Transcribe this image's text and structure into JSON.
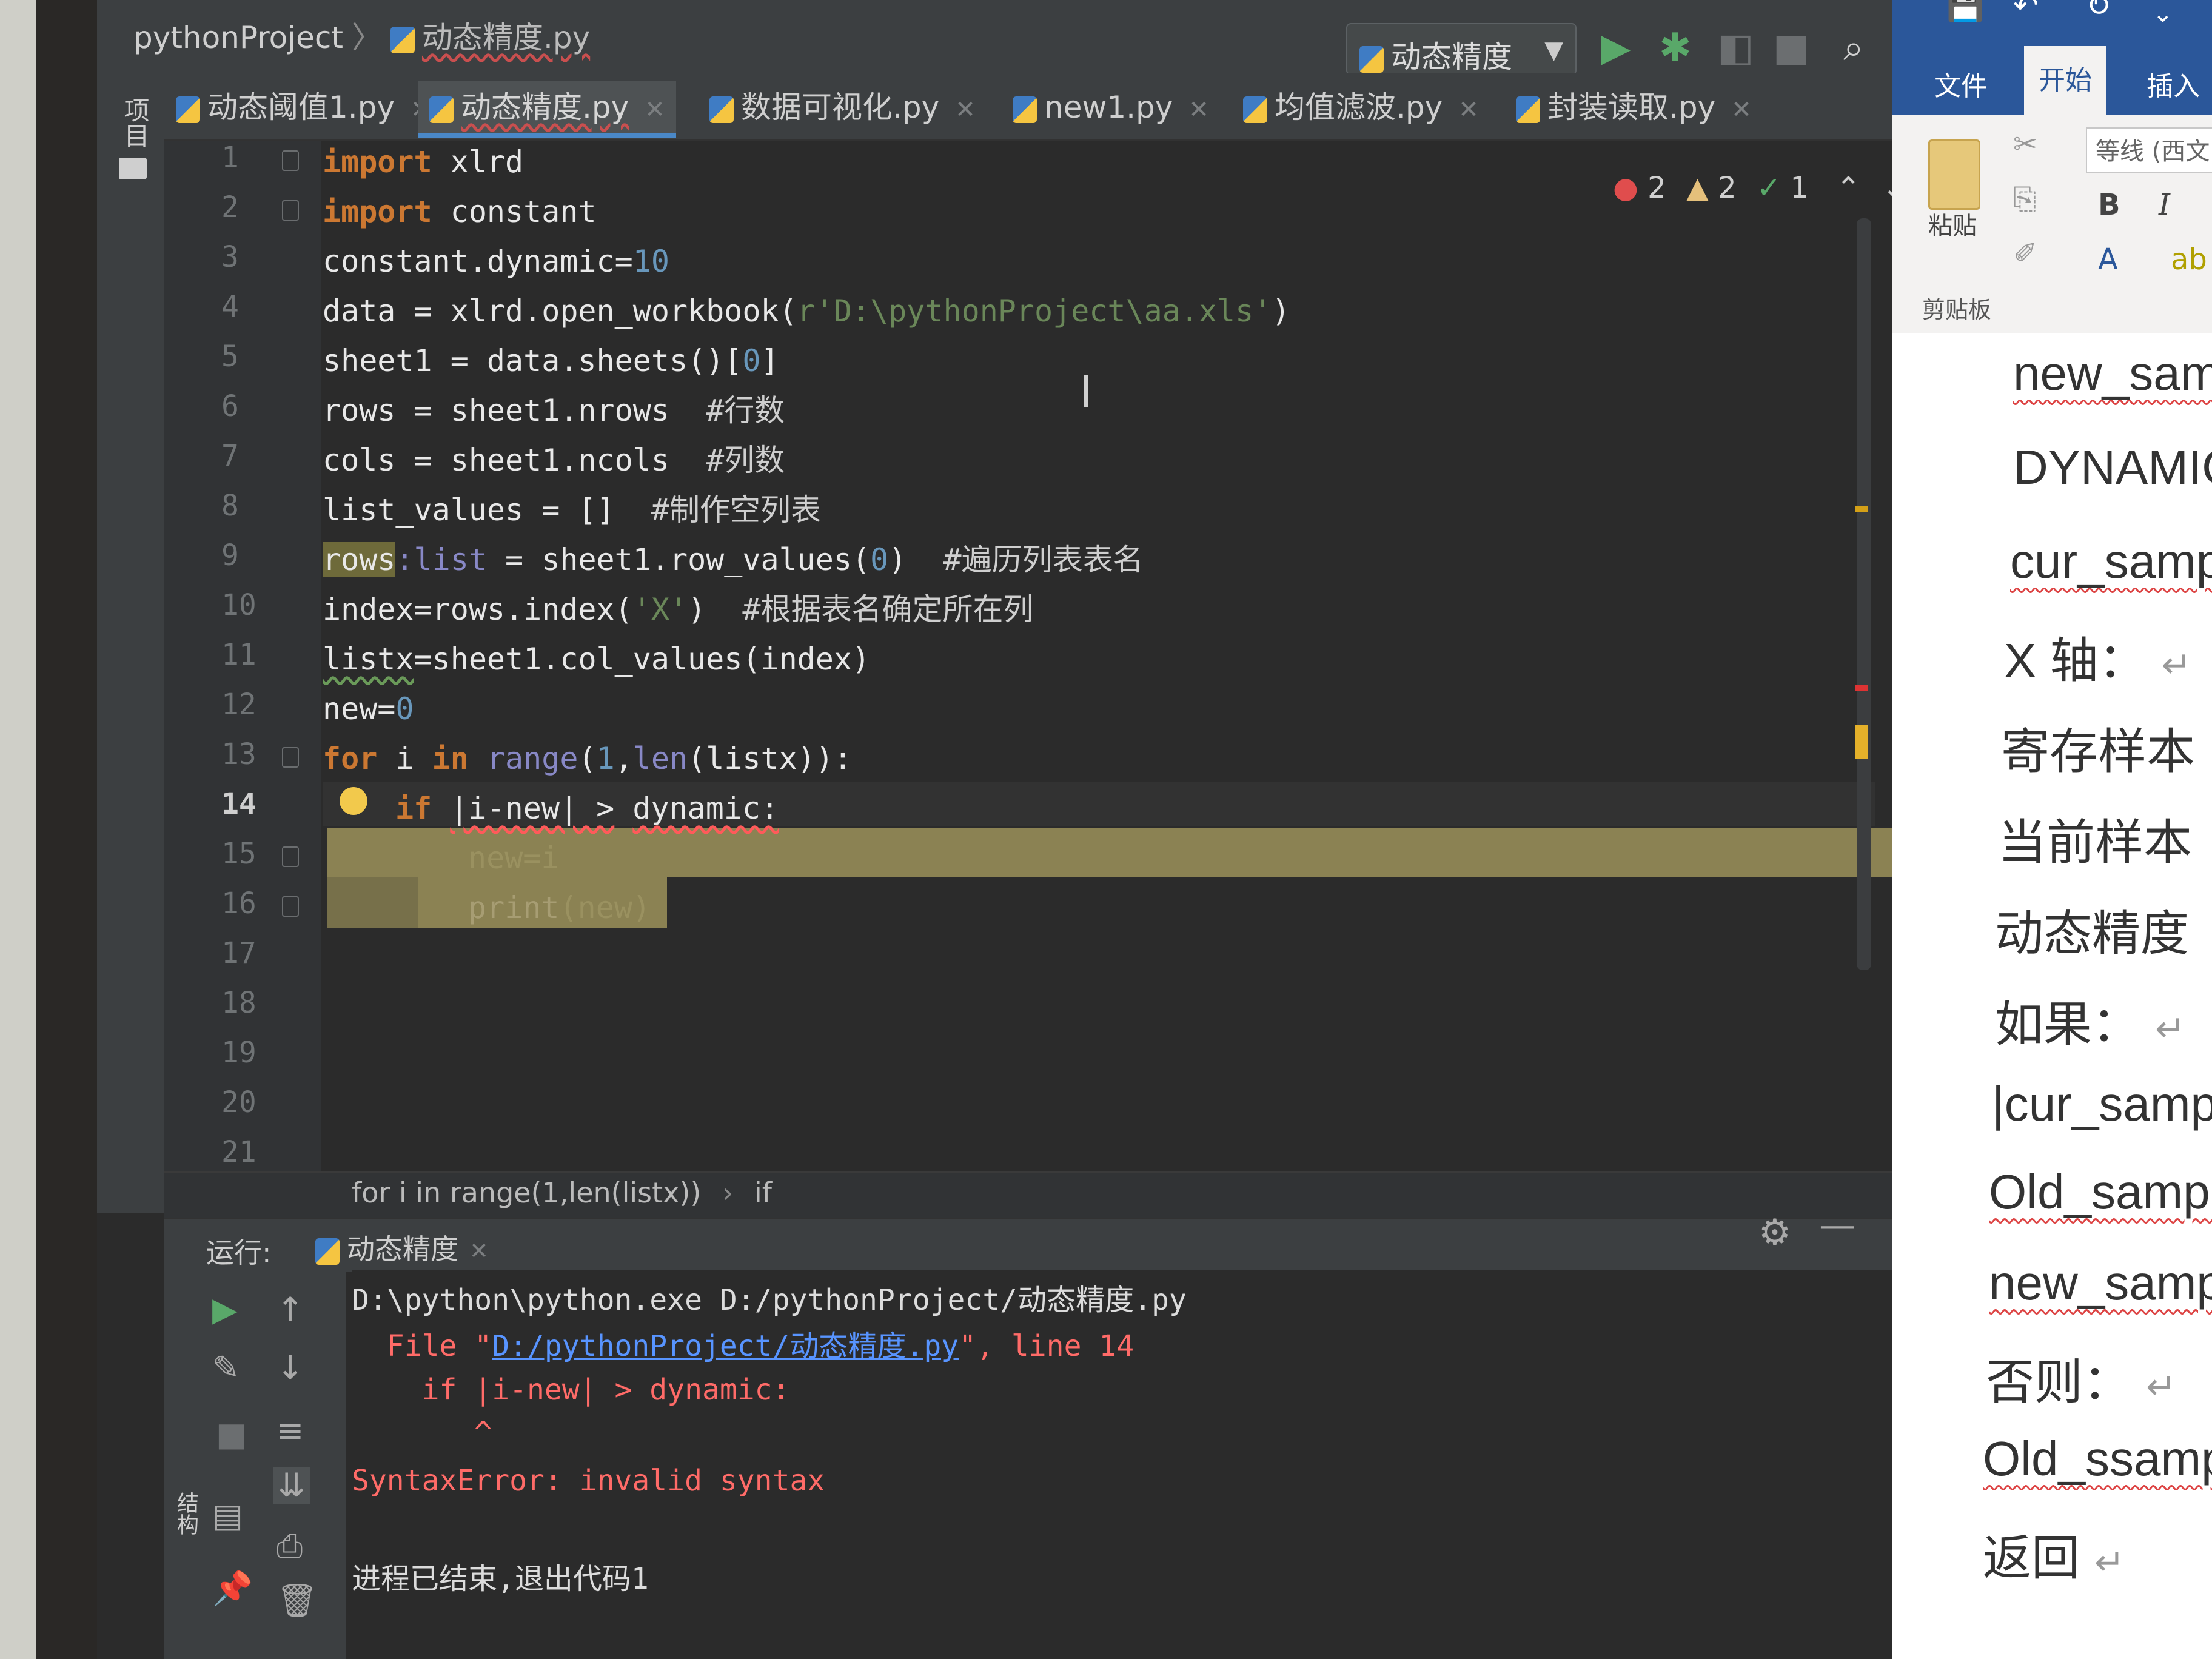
{
  "ide": {
    "project": "pythonProject",
    "current_file": "动态精度.py",
    "run_config": "动态精度",
    "side_project_label": "项目",
    "side_structure_label": "结构",
    "tabs": [
      {
        "label": "动态阈值1.py",
        "active": false
      },
      {
        "label": "动态精度.py",
        "active": true
      },
      {
        "label": "数据可视化.py",
        "active": false
      },
      {
        "label": "new1.py",
        "active": false
      },
      {
        "label": "均值滤波.py",
        "active": false
      },
      {
        "label": "封装读取.py",
        "active": false
      }
    ],
    "inspections": {
      "errors": "2",
      "warnings": "2",
      "typos": "1"
    },
    "line_numbers": [
      "1",
      "2",
      "3",
      "4",
      "5",
      "6",
      "7",
      "8",
      "9",
      "10",
      "11",
      "12",
      "13",
      "14",
      "15",
      "16",
      "17",
      "18",
      "19",
      "20",
      "21"
    ],
    "current_line": "14",
    "code": {
      "l1_kw": "import",
      "l1_rest": " xlrd",
      "l2_kw": "import",
      "l2_rest": " constant",
      "l3_a": "constant.dynamic=",
      "l3_num": "10",
      "l4_a": "data = xlrd.open_workbook(",
      "l4_str": "r'D:\\pythonProject\\aa.xls'",
      "l4_b": ")",
      "l5_a": "sheet1 = data.sheets()[",
      "l5_num": "0",
      "l5_b": "]",
      "l6_a": "rows = sheet1.nrows  ",
      "l6_cm": "#行数",
      "l7_a": "cols = sheet1.ncols  ",
      "l7_cm": "#列数",
      "l8_a": "list_values = []  ",
      "l8_cm": "#制作空列表",
      "l9_hl": "rows",
      "l9_type": ":list",
      "l9_a": " = sheet1.row_values(",
      "l9_num": "0",
      "l9_b": ")  ",
      "l9_cm": "#遍历列表表名",
      "l10_a": "index=rows.index(",
      "l10_str": "'X'",
      "l10_b": ")  ",
      "l10_cm": "#根据表名确定所在列",
      "l11_a": "listx",
      "l11_b": "=sheet1.col_values(index)",
      "l12_a": "new=",
      "l12_num": "0",
      "l13_kw1": "for",
      "l13_a": " i ",
      "l13_kw2": "in",
      "l13_sp": " ",
      "l13_bi1": "range",
      "l13_b": "(",
      "l13_num": "1",
      "l13_c": ",",
      "l13_bi2": "len",
      "l13_d": "(listx)):",
      "l14_kw": "if",
      "l14_err": "|i-new| >",
      "l14_b": " ",
      "l14_err2": "dynamic:",
      "l15": "new=i",
      "l16_bi": "print",
      "l16_b": "(new)"
    },
    "breadcrumb": [
      "for i in range(1,len(listx))",
      "if"
    ],
    "breadcrumb_sep": "›",
    "run": {
      "label": "运行:",
      "tab": "动态精度",
      "console": {
        "cmd": "D:\\python\\python.exe D:/pythonProject/动态精度.py",
        "file_pre": "  File \"",
        "file_link": "D:/pythonProject/动态精度.py",
        "file_post": "\", line 14",
        "code": "    if |i-new| > dynamic:",
        "caret": "       ^",
        "error": "SyntaxError: invalid syntax",
        "exit": "进程已结束,退出代码1"
      }
    }
  },
  "word": {
    "tabs": {
      "file": "文件",
      "home": "开始",
      "insert": "插入"
    },
    "paste": "粘贴",
    "clipboard": "剪贴板",
    "font": "等线 (西文",
    "bold": "B",
    "italic": "I",
    "lines": [
      "new_sam",
      "DYNAMIC",
      "cur_samp",
      "X 轴：",
      "寄存样本",
      "当前样本",
      "动态精度",
      "如果：",
      "|cur_samp",
      "Old_sampl",
      "new_samp",
      "否则：",
      "Old_ssamp",
      "返回"
    ]
  }
}
